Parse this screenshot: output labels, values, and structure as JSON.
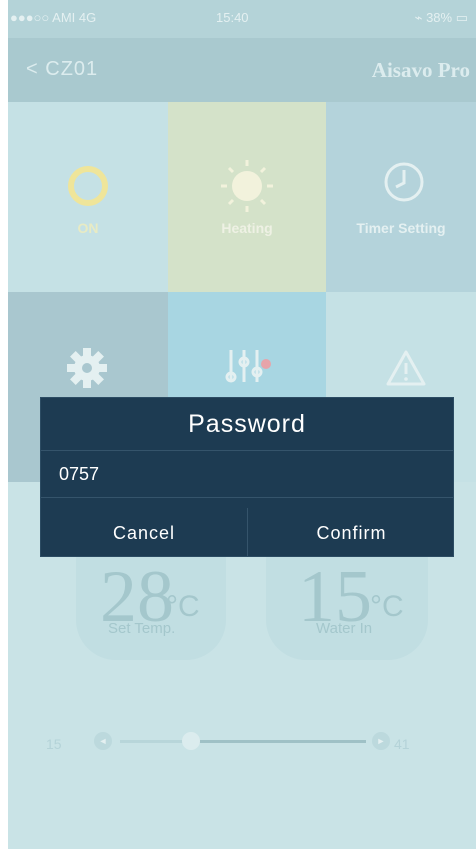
{
  "status_bar": {
    "carrier": "●●●○○ AMI 4G",
    "time": "15:40",
    "battery": "⌁ 38% ▭"
  },
  "nav": {
    "back_label": "CZ01",
    "brand": "Aisavo Pro"
  },
  "tiles": [
    {
      "label": "ON",
      "icon": "power-icon"
    },
    {
      "label": "Heating",
      "icon": "sun-icon"
    },
    {
      "label": "Timer Setting",
      "icon": "clock-icon"
    },
    {
      "label": "",
      "icon": "gear-icon"
    },
    {
      "label": "",
      "icon": "sliders-icon"
    },
    {
      "label": "",
      "icon": "warning-icon"
    }
  ],
  "set_temp": {
    "value": "28",
    "unit": "°C",
    "label": "Set Temp."
  },
  "water_in": {
    "value": "15",
    "unit": "°C",
    "label": "Water In"
  },
  "slider": {
    "min_label": "15",
    "max_label": "41",
    "value_fraction": 0.27
  },
  "dialog": {
    "title": "Password",
    "input_value": "0757",
    "cancel_label": "Cancel",
    "confirm_label": "Confirm"
  },
  "colors": {
    "overlay_bg": "#c9e3e6",
    "dialog_bg": "#1d3b52",
    "tile_on": "#e6efc9",
    "tile_heating": "#d4e2c9",
    "tile_timer": "#b4d3db",
    "tile_settings": "#a9c7cf",
    "tile_tuning": "#a8d6e2",
    "tile_error": "#c5e1e5",
    "accent_yellow": "#efe59a"
  }
}
